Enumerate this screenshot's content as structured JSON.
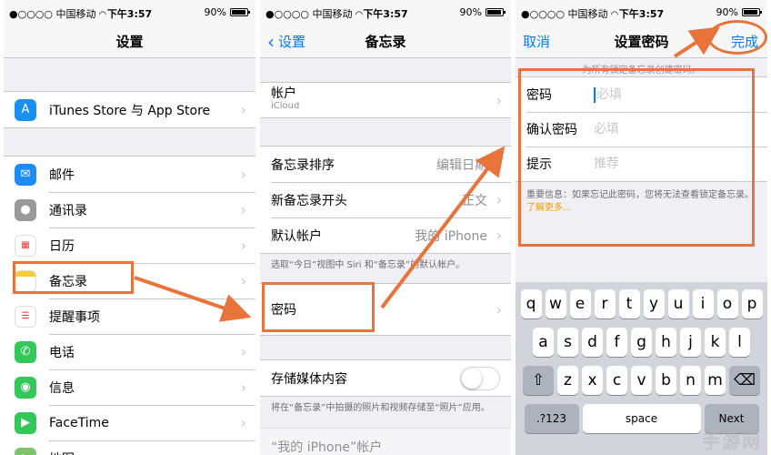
{
  "status": {
    "carrier": "●○○○○ 中国移动",
    "time": "下午3:57",
    "battery": "90%"
  },
  "panel1": {
    "title": "设置",
    "itunes": "iTunes Store 与 App Store",
    "items": [
      {
        "label": "邮件",
        "icon": "mail-icon"
      },
      {
        "label": "通讯录",
        "icon": "contacts-icon"
      },
      {
        "label": "日历",
        "icon": "calendar-icon"
      },
      {
        "label": "备忘录",
        "icon": "notes-icon"
      },
      {
        "label": "提醒事项",
        "icon": "reminders-icon"
      },
      {
        "label": "电话",
        "icon": "phone-icon"
      },
      {
        "label": "信息",
        "icon": "messages-icon"
      },
      {
        "label": "FaceTime",
        "icon": "facetime-icon"
      },
      {
        "label": "地图",
        "icon": "maps-icon"
      }
    ]
  },
  "panel2": {
    "back": "设置",
    "title": "备忘录",
    "account_label": "帐户",
    "account_sub": "iCloud",
    "sort_label": "备忘录排序",
    "sort_value": "编辑日期",
    "new_note_label": "新备忘录开头",
    "new_note_value": "正文",
    "default_account_label": "默认帐户",
    "default_account_value": "我的 iPhone",
    "default_account_note": "选取“今日”视图中 Siri 和“备忘录”的默认帐户。",
    "password_label": "密码",
    "save_media_label": "存储媒体内容",
    "save_media_note": "将在“备忘录”中拍摄的照片和视频存储至“照片”应用。",
    "bottom_partial": "“我的 iPhone”帐户"
  },
  "panel3": {
    "cancel": "取消",
    "title": "设置密码",
    "done": "完成",
    "hint": "为所有锁定备忘录创建密码。",
    "password_label": "密码",
    "password_placeholder": "必填",
    "confirm_label": "确认密码",
    "confirm_placeholder": "必填",
    "hint_label": "提示",
    "hint_placeholder": "推荐",
    "warning": "重要信息：如果忘记此密码，您将无法查看锁定备忘录。",
    "learn_more": "了解更多…"
  },
  "keyboard": {
    "row1": [
      "q",
      "w",
      "e",
      "r",
      "t",
      "y",
      "u",
      "i",
      "o",
      "p"
    ],
    "row2": [
      "a",
      "s",
      "d",
      "f",
      "g",
      "h",
      "j",
      "k",
      "l"
    ],
    "row3": [
      "z",
      "x",
      "c",
      "v",
      "b",
      "n",
      "m"
    ],
    "numbers": ".?123",
    "space": "space",
    "next": "Next"
  },
  "watermark": "手游网",
  "colors": {
    "annotation": "#e8743b",
    "ios_blue": "#007aff"
  }
}
